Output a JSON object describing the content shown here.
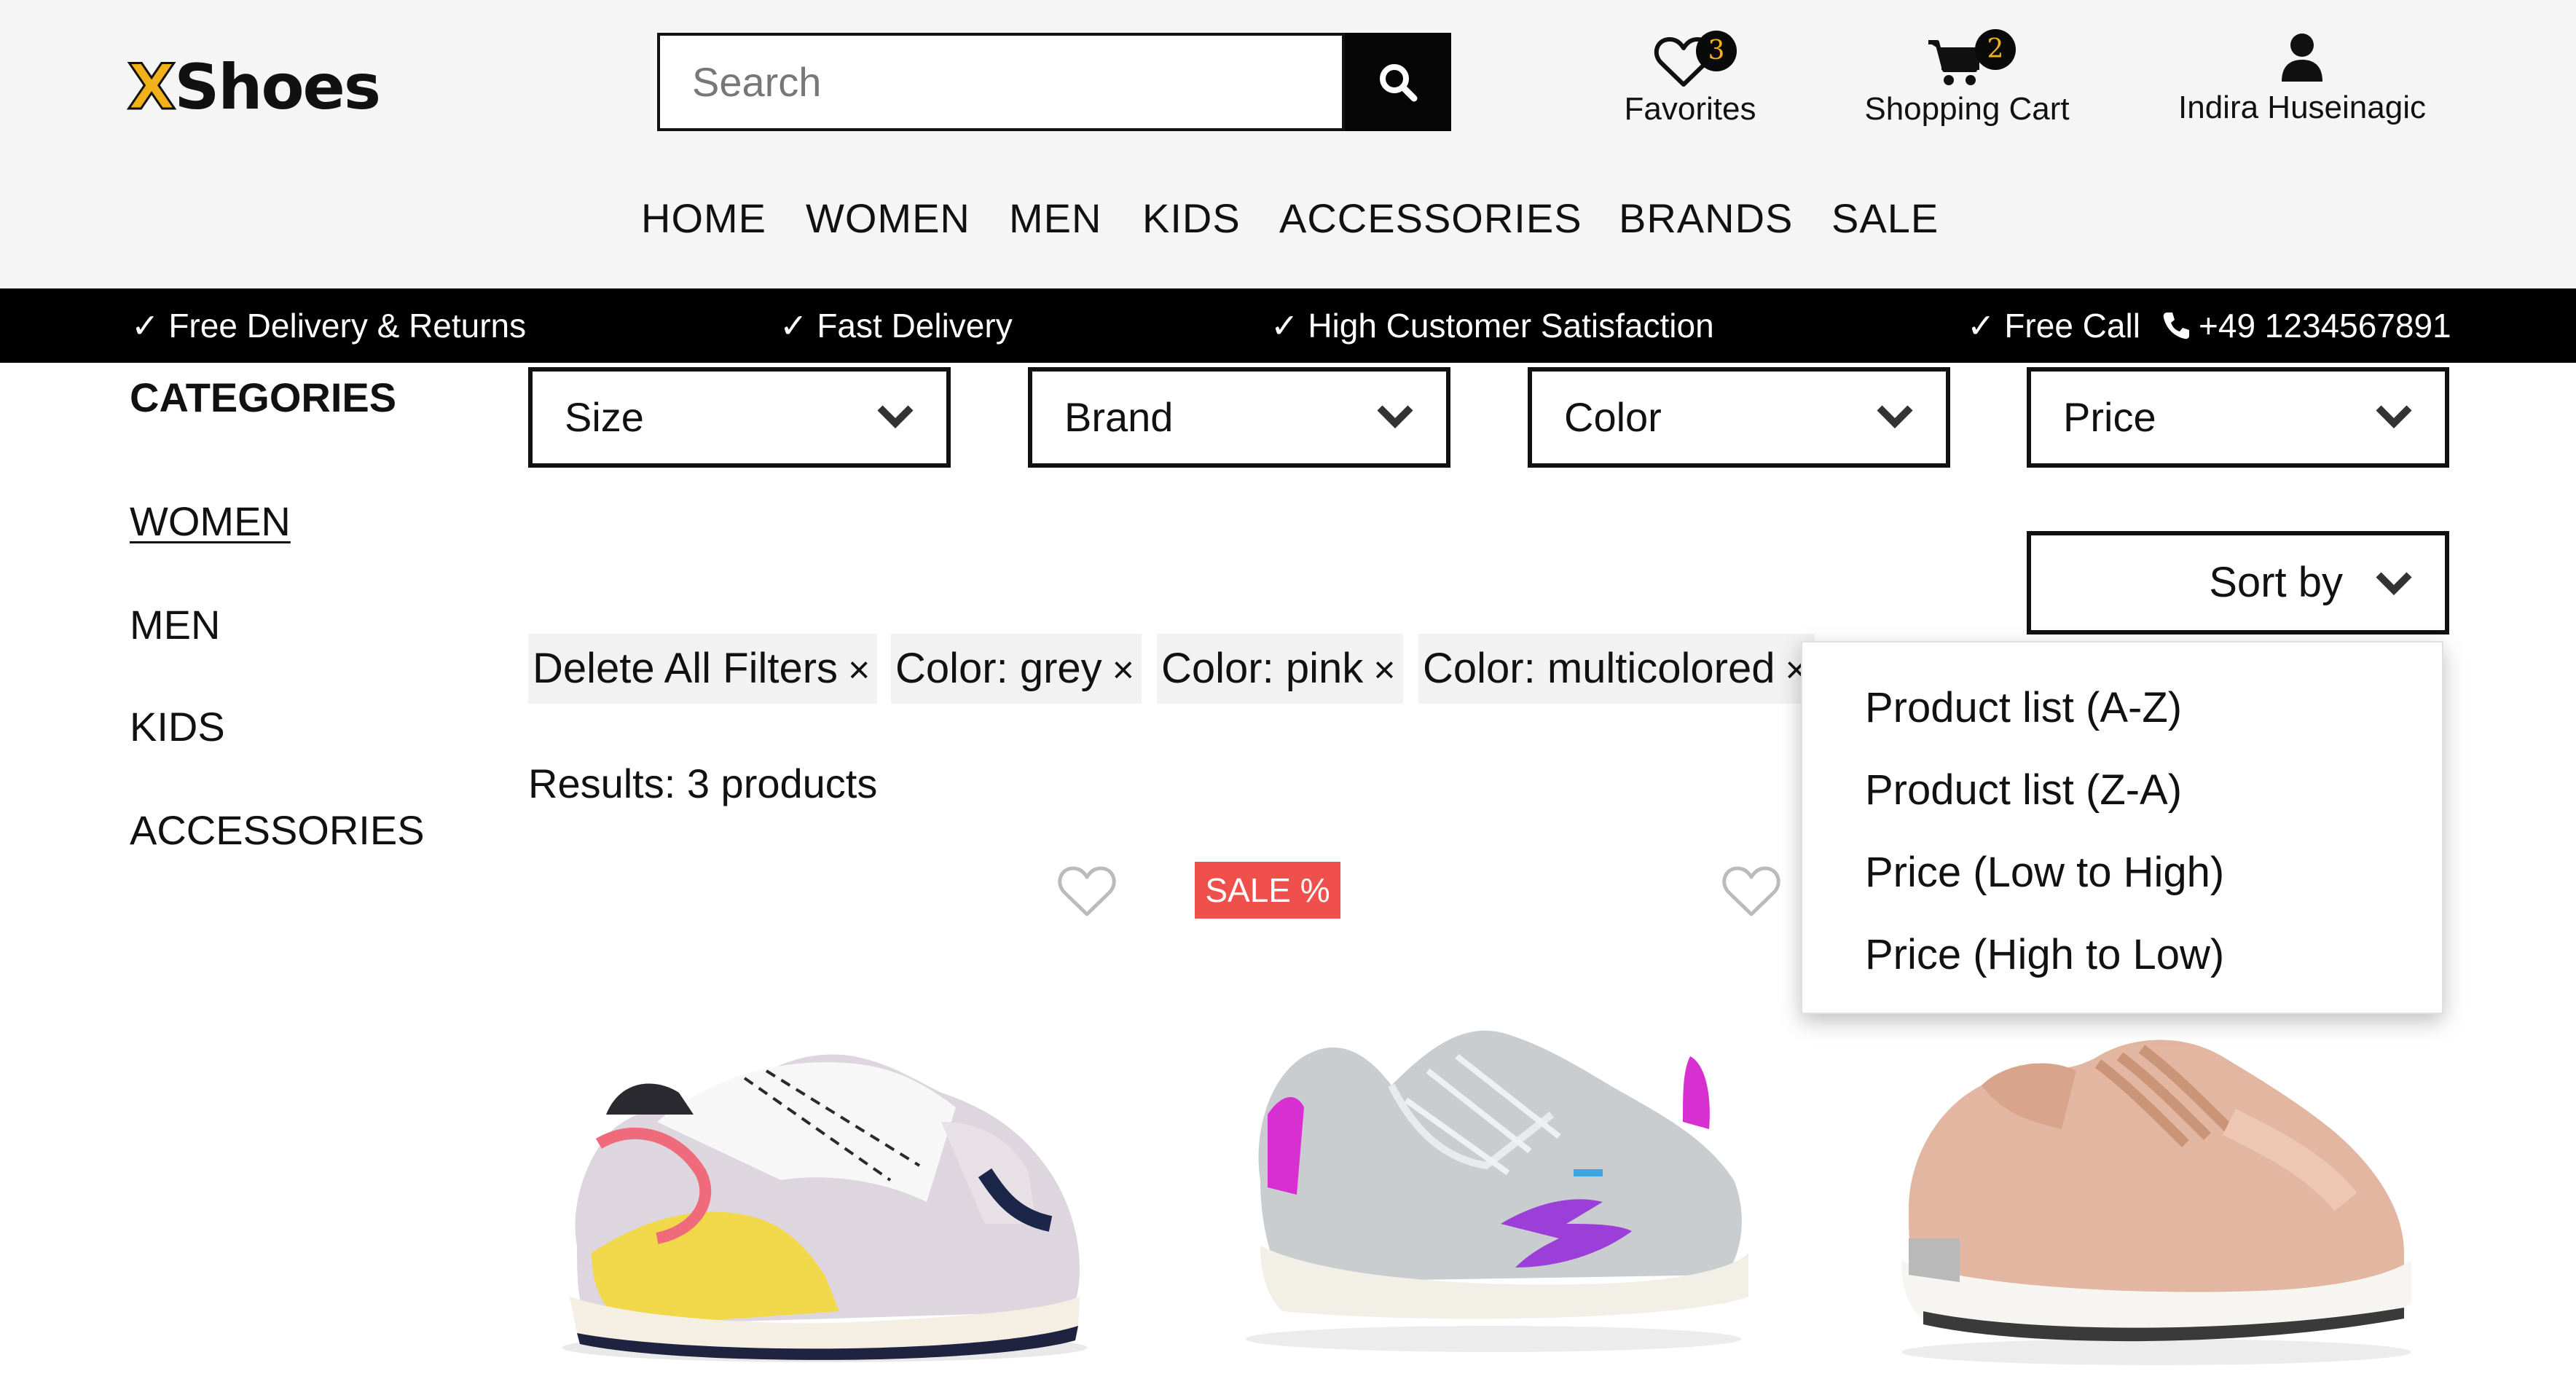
{
  "header": {
    "logo_x": "X",
    "logo_rest": "Shoes",
    "search_placeholder": "Search",
    "favorites": {
      "label": "Favorites",
      "count": "3"
    },
    "cart": {
      "label": "Shopping Cart",
      "count": "2"
    },
    "user": {
      "name": "Indira Huseinagic"
    }
  },
  "nav": [
    "HOME",
    "WOMEN",
    "MEN",
    "KIDS",
    "ACCESSORIES",
    "BRANDS",
    "SALE"
  ],
  "banner": {
    "free_delivery": "✓ Free Delivery & Returns",
    "fast_delivery": "✓ Fast Delivery",
    "satisfaction": "✓ High Customer Satisfaction",
    "free_call": "✓ Free Call",
    "phone": "+49 1234567891"
  },
  "sidebar": {
    "title": "CATEGORIES",
    "items": [
      {
        "label": "WOMEN",
        "active": true
      },
      {
        "label": "MEN",
        "active": false
      },
      {
        "label": "KIDS",
        "active": false
      },
      {
        "label": "ACCESSORIES",
        "active": false
      }
    ]
  },
  "filters": [
    "Size",
    "Brand",
    "Color",
    "Price"
  ],
  "sort": {
    "label": "Sort by",
    "options": [
      "Product list (A-Z)",
      "Product list (Z-A)",
      "Price (Low to High)",
      "Price (High to Low)"
    ]
  },
  "active_filters": [
    "Delete All Filters",
    "Color: grey",
    "Color: pink",
    "Color: multicolored"
  ],
  "chip_close": "×",
  "results": "Results: 3 products",
  "products": [
    {
      "colors": [
        "yellow",
        "pink",
        "grey",
        "navy",
        "white"
      ],
      "sale": false
    },
    {
      "colors": [
        "grey",
        "magenta",
        "purple",
        "blue"
      ],
      "sale": true,
      "sale_label": "SALE %"
    },
    {
      "colors": [
        "pink",
        "beige",
        "silver"
      ],
      "sale": false
    }
  ],
  "colors": {
    "header_bg": "#f5f5f6",
    "banner_bg": "#000000",
    "logo_accent": "#f2b11b",
    "badge_text": "#f2b11b",
    "sale_bg": "#f0504c",
    "chip_bg": "#f2f2f2"
  }
}
